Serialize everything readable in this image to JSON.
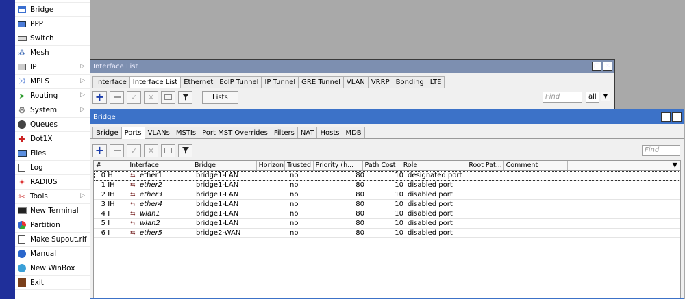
{
  "sidebar": {
    "items": [
      {
        "label": "Bridge",
        "icon": "bridge-icon",
        "submenu": false
      },
      {
        "label": "PPP",
        "icon": "ppp-icon",
        "submenu": false
      },
      {
        "label": "Switch",
        "icon": "switch-icon",
        "submenu": false
      },
      {
        "label": "Mesh",
        "icon": "mesh-icon",
        "submenu": false
      },
      {
        "label": "IP",
        "icon": "ip-icon",
        "submenu": true
      },
      {
        "label": "MPLS",
        "icon": "mpls-icon",
        "submenu": true
      },
      {
        "label": "Routing",
        "icon": "routing-icon",
        "submenu": true
      },
      {
        "label": "System",
        "icon": "system-gear-icon",
        "submenu": true
      },
      {
        "label": "Queues",
        "icon": "queues-icon",
        "submenu": false
      },
      {
        "label": "Dot1X",
        "icon": "dot1x-icon",
        "submenu": false
      },
      {
        "label": "Files",
        "icon": "files-folder-icon",
        "submenu": false
      },
      {
        "label": "Log",
        "icon": "log-icon",
        "submenu": false
      },
      {
        "label": "RADIUS",
        "icon": "radius-icon",
        "submenu": false
      },
      {
        "label": "Tools",
        "icon": "tools-icon",
        "submenu": true
      },
      {
        "label": "New Terminal",
        "icon": "terminal-icon",
        "submenu": false
      },
      {
        "label": "Partition",
        "icon": "partition-icon",
        "submenu": false
      },
      {
        "label": "Make Supout.rif",
        "icon": "supout-file-icon",
        "submenu": false
      },
      {
        "label": "Manual",
        "icon": "manual-icon",
        "submenu": false
      },
      {
        "label": "New WinBox",
        "icon": "winbox-icon",
        "submenu": false
      },
      {
        "label": "Exit",
        "icon": "exit-icon",
        "submenu": false
      }
    ],
    "submenu_glyph": "▷"
  },
  "interface_window": {
    "title": "Interface List",
    "tabs": [
      "Interface",
      "Interface List",
      "Ethernet",
      "EoIP Tunnel",
      "IP Tunnel",
      "GRE Tunnel",
      "VLAN",
      "VRRP",
      "Bonding",
      "LTE"
    ],
    "active_tab": 1,
    "lists_button": "Lists",
    "find_placeholder": "Find",
    "filter_value": "all",
    "filter_arrow": "▼"
  },
  "bridge_window": {
    "title": "Bridge",
    "tabs": [
      "Bridge",
      "Ports",
      "VLANs",
      "MSTIs",
      "Port MST Overrides",
      "Filters",
      "NAT",
      "Hosts",
      "MDB"
    ],
    "active_tab": 1,
    "find_placeholder": "Find",
    "columns": [
      "#",
      "Interface",
      "Bridge",
      "Horizon",
      "Trusted",
      "Priority (h...",
      "Path Cost",
      "Role",
      "Root Pat...",
      "Comment"
    ],
    "rows": [
      {
        "num": "0",
        "flags": "H",
        "iface": "ether1",
        "bridge": "bridge1-LAN",
        "horizon": "",
        "trusted": "no",
        "priority": "80",
        "path_cost": "10",
        "role": "designated port",
        "italic": false
      },
      {
        "num": "1",
        "flags": "IH",
        "iface": "ether2",
        "bridge": "bridge1-LAN",
        "horizon": "",
        "trusted": "no",
        "priority": "80",
        "path_cost": "10",
        "role": "disabled port",
        "italic": true
      },
      {
        "num": "2",
        "flags": "IH",
        "iface": "ether3",
        "bridge": "bridge1-LAN",
        "horizon": "",
        "trusted": "no",
        "priority": "80",
        "path_cost": "10",
        "role": "disabled port",
        "italic": true
      },
      {
        "num": "3",
        "flags": "IH",
        "iface": "ether4",
        "bridge": "bridge1-LAN",
        "horizon": "",
        "trusted": "no",
        "priority": "80",
        "path_cost": "10",
        "role": "disabled port",
        "italic": true
      },
      {
        "num": "4",
        "flags": "I",
        "iface": "wlan1",
        "bridge": "bridge1-LAN",
        "horizon": "",
        "trusted": "no",
        "priority": "80",
        "path_cost": "10",
        "role": "disabled port",
        "italic": true
      },
      {
        "num": "5",
        "flags": "I",
        "iface": "wlan2",
        "bridge": "bridge1-LAN",
        "horizon": "",
        "trusted": "no",
        "priority": "80",
        "path_cost": "10",
        "role": "disabled port",
        "italic": true
      },
      {
        "num": "6",
        "flags": "I",
        "iface": "ether5",
        "bridge": "bridge2-WAN",
        "horizon": "",
        "trusted": "no",
        "priority": "80",
        "path_cost": "10",
        "role": "disabled port",
        "italic": true
      }
    ]
  },
  "colors": {
    "sidebar_strip": "#1f2f9a",
    "desktop": "#a9a9a9",
    "title_inactive": "#7d8fb0",
    "title_active": "#3c72c8",
    "add_blue": "#1c3eaa"
  }
}
